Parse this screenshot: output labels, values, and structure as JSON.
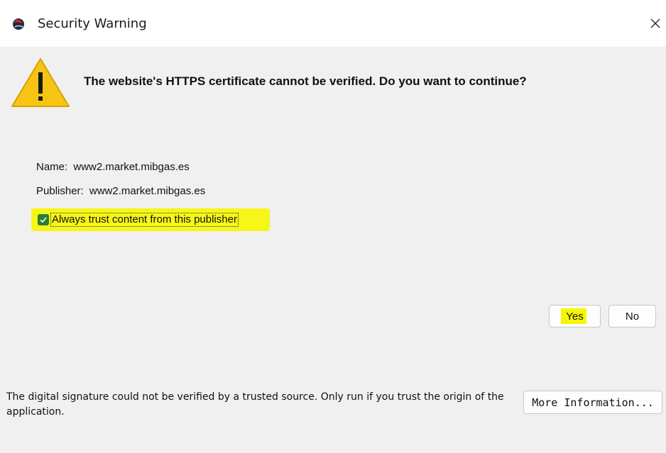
{
  "window": {
    "title": "Security Warning",
    "app_icon": "java-cup-icon",
    "close_icon": "close-icon"
  },
  "warning": {
    "icon": "warning-triangle-icon",
    "headline": "The website's HTTPS certificate cannot be verified. Do you want to continue?"
  },
  "details": {
    "name_label": "Name:",
    "name_value": "www2.market.mibgas.es",
    "publisher_label": "Publisher:",
    "publisher_value": "www2.market.mibgas.es"
  },
  "trust": {
    "checked": true,
    "label": "Always trust content from this publisher"
  },
  "buttons": {
    "yes": "Yes",
    "no": "No",
    "more_info": "More Information..."
  },
  "footer": {
    "text": "The digital signature could not be verified by a trusted source. Only run if you trust the origin of the application."
  },
  "colors": {
    "highlight": "#f6f600",
    "checkbox": "#2e7d32",
    "warning_fill": "#f7c414"
  }
}
